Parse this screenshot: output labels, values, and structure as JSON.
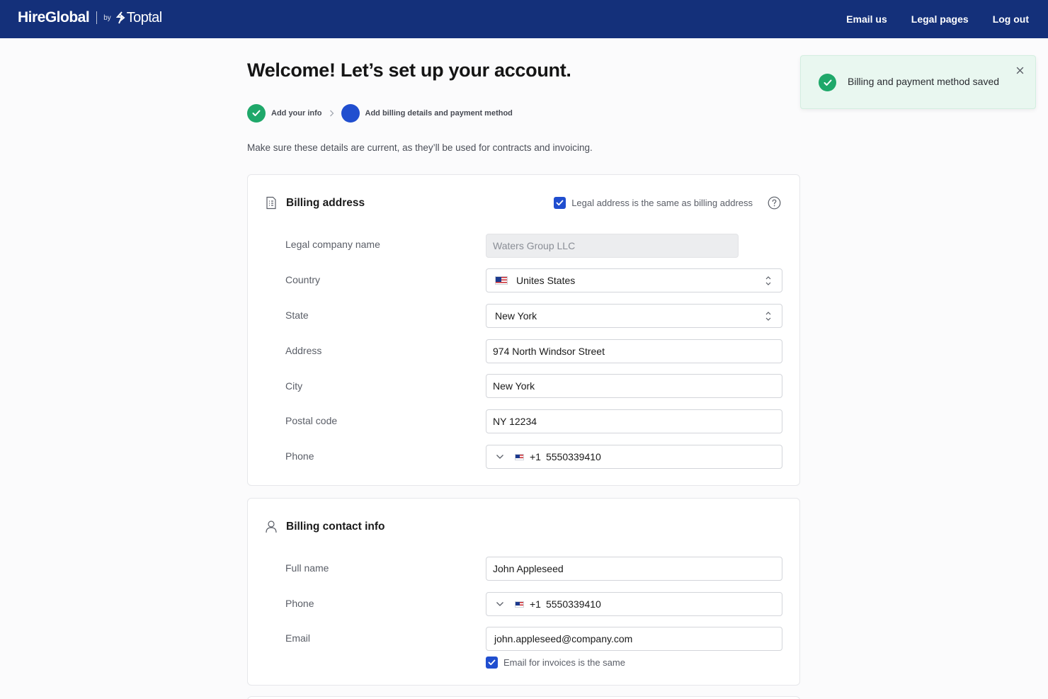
{
  "header": {
    "brand_name": "HireGlobal",
    "brand_by": "by",
    "brand_partner": "Toptal",
    "nav": [
      "Email us",
      "Legal pages",
      "Log out"
    ]
  },
  "page": {
    "title": "Welcome! Let’s set up your account.",
    "subtitle": "Make sure these details are current, as they’ll be used for contracts and invoicing."
  },
  "stepper": {
    "steps": [
      {
        "label": "Add your info",
        "status": "done"
      },
      {
        "label": "Add billing details and payment method",
        "status": "active"
      }
    ]
  },
  "billing_address": {
    "title": "Billing address",
    "same_as_billing_label": "Legal address is the same as billing address",
    "same_as_billing_checked": true,
    "fields": {
      "company": {
        "label": "Legal company name",
        "value": "Waters Group LLC"
      },
      "country": {
        "label": "Country",
        "value": "Unites States"
      },
      "state": {
        "label": "State",
        "value": "New York"
      },
      "address": {
        "label": "Address",
        "value": "974 North Windsor Street"
      },
      "city": {
        "label": "City",
        "value": "New York"
      },
      "postal": {
        "label": "Postal code",
        "value": "NY 12234"
      },
      "phone": {
        "label": "Phone",
        "code": "+1",
        "value": "5550339410"
      }
    }
  },
  "billing_contact": {
    "title": "Billing contact info",
    "fields": {
      "full_name": {
        "label": "Full name",
        "value": "John Appleseed"
      },
      "phone": {
        "label": "Phone",
        "code": "+1",
        "value": "5550339410"
      },
      "email": {
        "label": "Email",
        "value": "john.appleseed@company.com"
      }
    },
    "email_same_label": "Email for invoices is the same",
    "email_same_checked": true
  },
  "toast": {
    "message": "Billing and payment method saved"
  },
  "colors": {
    "header_bg": "#14307a",
    "accent": "#204ecf",
    "success": "#1fa86a"
  },
  "icons": [
    "check-icon",
    "chevron-right-icon",
    "document-icon",
    "help-circle-icon",
    "select-arrows-icon",
    "us-flag-icon",
    "chevron-down-icon",
    "user-icon",
    "close-icon"
  ]
}
